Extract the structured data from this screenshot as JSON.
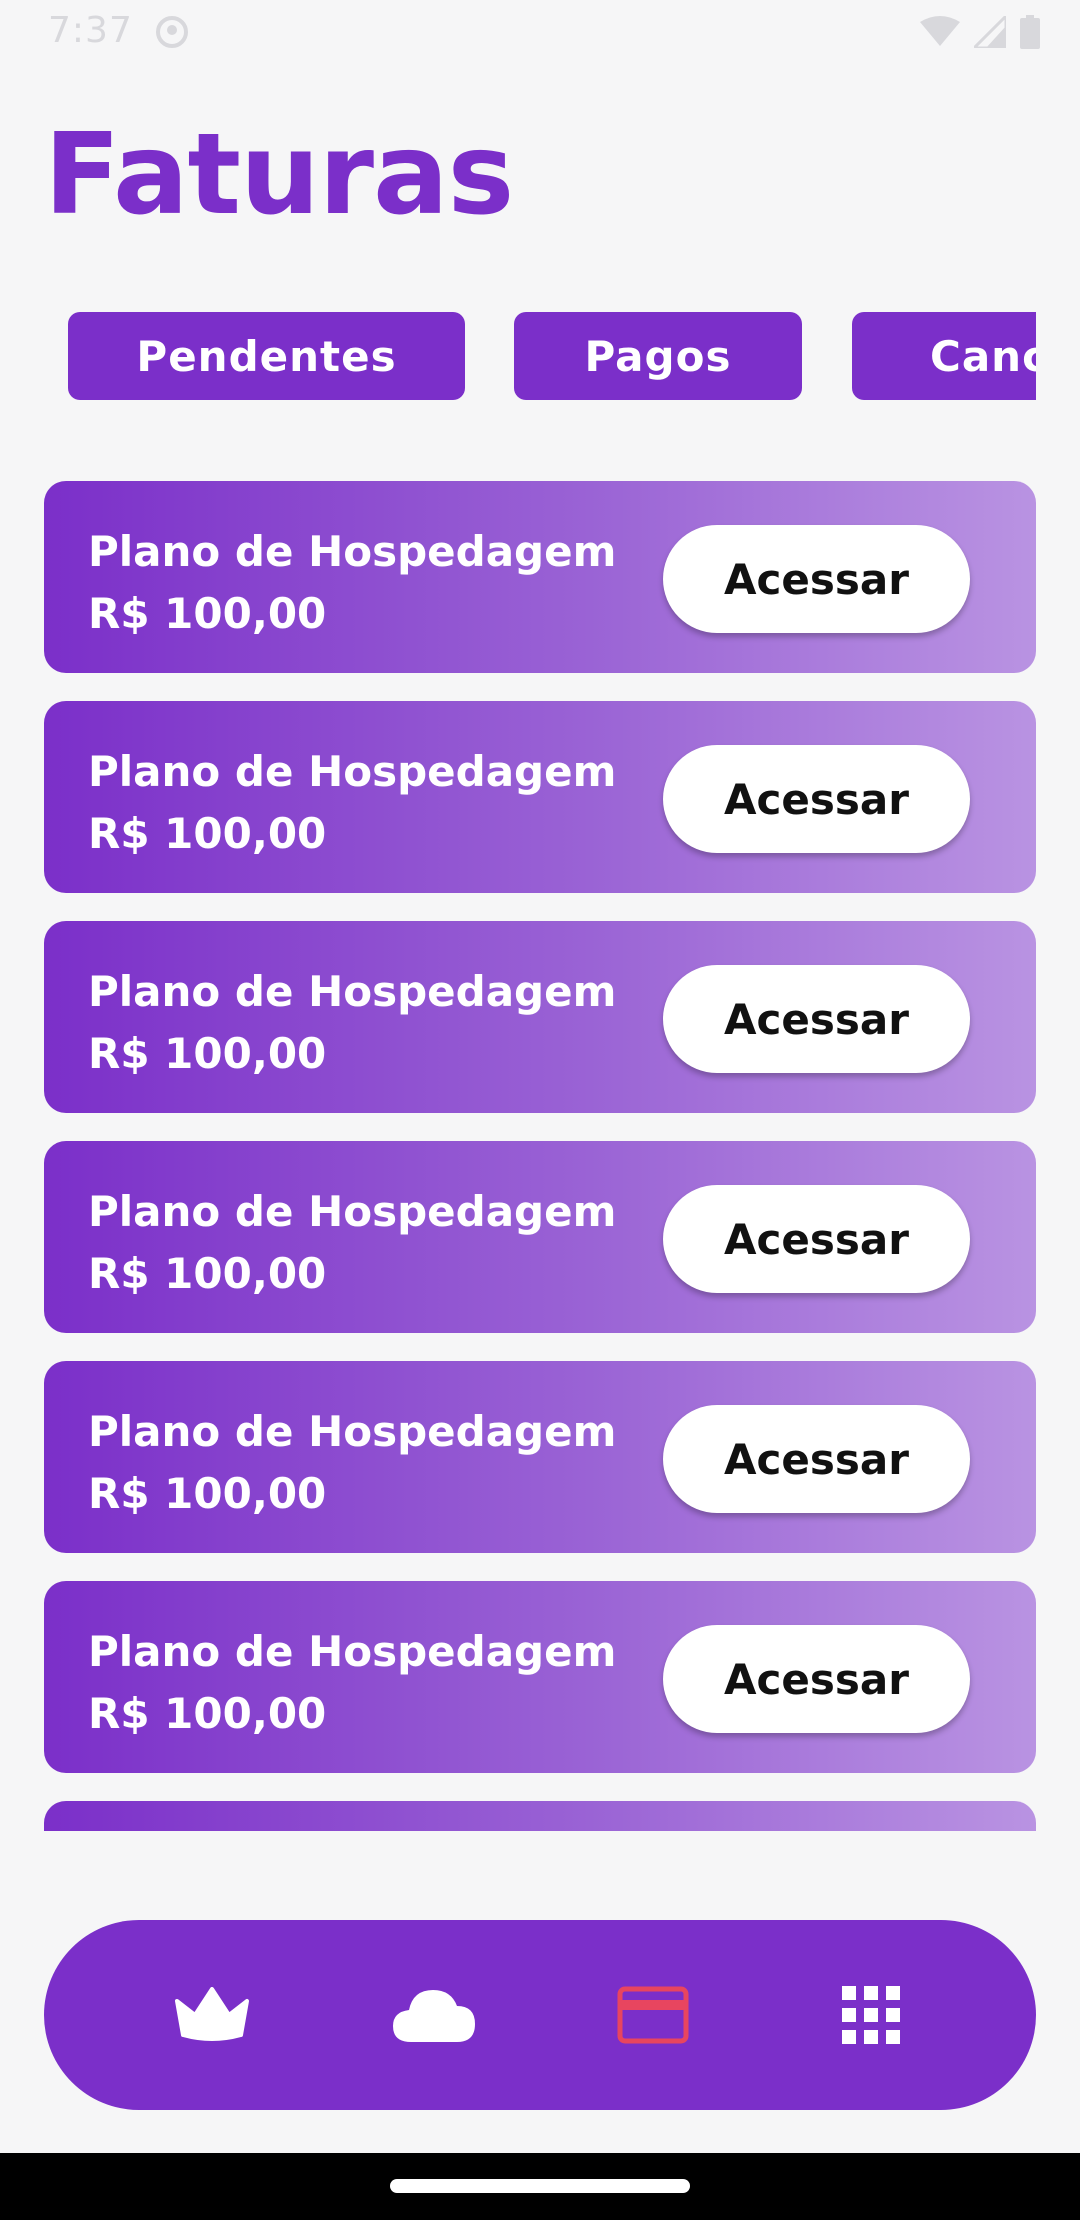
{
  "status_bar": {
    "time": "7:37"
  },
  "page_title": "Faturas",
  "tabs": [
    {
      "label": "Pendentes"
    },
    {
      "label": "Pagos"
    },
    {
      "label": "Canc"
    }
  ],
  "invoices": [
    {
      "title": "Plano de Hospedagem",
      "price": "R$ 100,00",
      "button": "Acessar"
    },
    {
      "title": "Plano de Hospedagem",
      "price": "R$ 100,00",
      "button": "Acessar"
    },
    {
      "title": "Plano de Hospedagem",
      "price": "R$ 100,00",
      "button": "Acessar"
    },
    {
      "title": "Plano de Hospedagem",
      "price": "R$ 100,00",
      "button": "Acessar"
    },
    {
      "title": "Plano de Hospedagem",
      "price": "R$ 100,00",
      "button": "Acessar"
    },
    {
      "title": "Plano de Hospedagem",
      "price": "R$ 100,00",
      "button": "Acessar"
    }
  ],
  "bottom_nav": {
    "items": [
      {
        "icon": "crown-icon"
      },
      {
        "icon": "cloud-icon"
      },
      {
        "icon": "credit-card-icon",
        "active": true
      },
      {
        "icon": "grid-icon"
      }
    ]
  },
  "colors": {
    "brand": "#7b2fc9",
    "active_icon": "#e8455f",
    "background": "#f6f6f7"
  }
}
